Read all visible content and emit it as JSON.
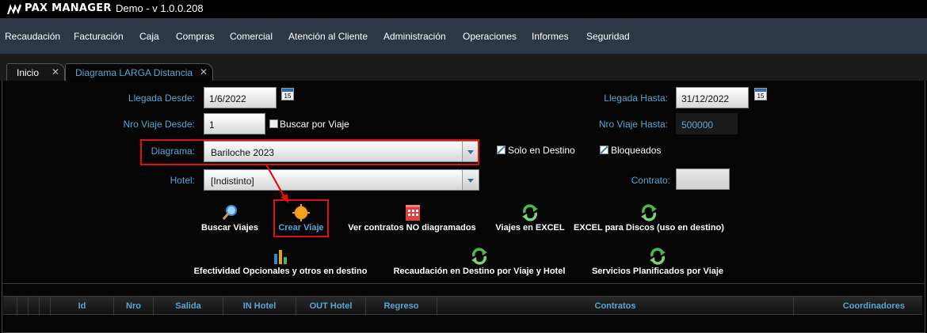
{
  "app": {
    "brand": "PAX MANAGER",
    "title": "Demo - v 1.0.0.208"
  },
  "menu": [
    "Recaudación",
    "Facturación",
    "Caja",
    "Compras",
    "Comercial",
    "Atención al Cliente",
    "Administración",
    "Operaciones",
    "Informes",
    "Seguridad"
  ],
  "tabs": [
    {
      "label": "Inicio",
      "close": "✕"
    },
    {
      "label": "Diagrama LARGA Distancia",
      "close": "✕"
    }
  ],
  "form": {
    "llegada_desde_label": "Llegada Desde:",
    "llegada_desde_value": "1/6/2022",
    "llegada_hasta_label": "Llegada Hasta:",
    "llegada_hasta_value": "31/12/2022",
    "calendar_text": "15",
    "nro_viaje_desde_label": "Nro Viaje Desde:",
    "nro_viaje_desde_value": "1",
    "buscar_por_viaje_label": "Buscar por Viaje",
    "nro_viaje_hasta_label": "Nro Viaje Hasta:",
    "nro_viaje_hasta_value": "500000",
    "diagrama_label": "Diagrama:",
    "diagrama_value": "Bariloche 2023",
    "solo_en_destino_label": "Solo en Destino",
    "bloqueados_label": "Bloqueados",
    "hotel_label": "Hotel:",
    "hotel_value": "[Indistinto]",
    "contrato_label": "Contrato:",
    "contrato_value": ""
  },
  "actions": {
    "buscar_viajes": "Buscar Viajes",
    "crear_viaje": "Crear Viaje",
    "ver_contratos": "Ver contratos NO diagramados",
    "viajes_excel": "Viajes en EXCEL",
    "excel_discos": "EXCEL para Discos (uso en destino)",
    "efectividad": "Efectividad Opcionales y otros en destino",
    "recaudacion": "Recaudación en Destino por Viaje y Hotel",
    "servicios": "Servicios Planificados por Viaje"
  },
  "grid": {
    "columns": [
      "Id",
      "Nro",
      "Salida",
      "IN Hotel",
      "OUT Hotel",
      "Regreso",
      "Contratos",
      "Coordinadores"
    ]
  },
  "colors": {
    "menubar": "#2e3746",
    "label_blue": "#5aa6d4",
    "highlight_red": "#e01010"
  },
  "icons": [
    "logo-icon",
    "calendar-icon",
    "search-icon",
    "sun-gear-icon",
    "building-icon",
    "refresh-icon",
    "bar-chart-icon"
  ]
}
